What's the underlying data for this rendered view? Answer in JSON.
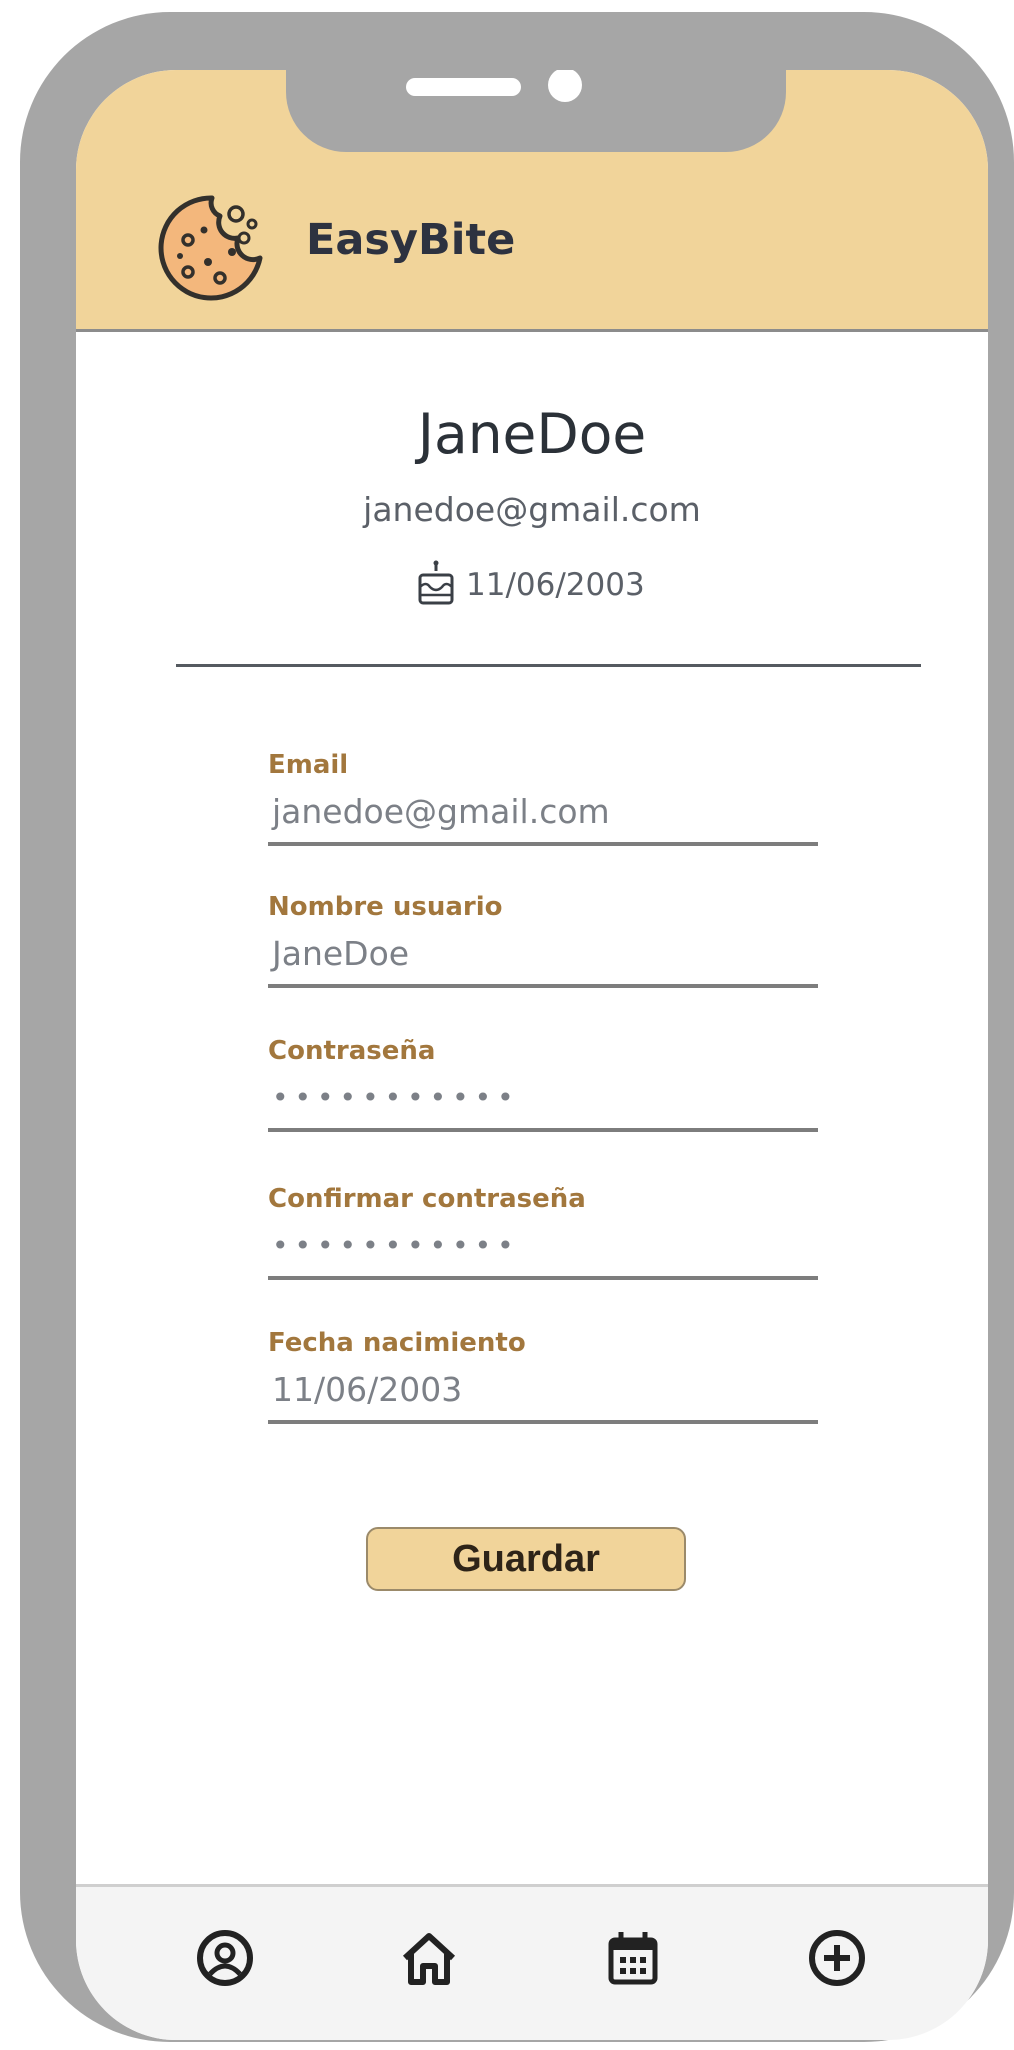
{
  "app": {
    "name": "EasyBite",
    "logo_icon": "cookie-icon"
  },
  "colors": {
    "header_bg": "#f1d49a",
    "label_accent": "#a2773d",
    "frame": "#a6a6a6"
  },
  "profile": {
    "username": "JaneDoe",
    "email": "janedoe@gmail.com",
    "birth_icon": "birthday-cake-icon",
    "birth_date": "11/06/2003"
  },
  "form": {
    "fields": [
      {
        "label": "Email",
        "value": "janedoe@gmail.com"
      },
      {
        "label": "Nombre usuario",
        "value": "JaneDoe"
      },
      {
        "label": "Contraseña",
        "value": "•••••••••••"
      },
      {
        "label": "Confirmar contraseña",
        "value": "•••••••••••"
      },
      {
        "label": "Fecha nacimiento",
        "value": "11/06/2003"
      }
    ],
    "save_label": "Guardar"
  },
  "nav": {
    "items": [
      {
        "icon": "user-profile-icon"
      },
      {
        "icon": "home-icon"
      },
      {
        "icon": "calendar-icon"
      },
      {
        "icon": "add-circle-icon"
      }
    ]
  }
}
